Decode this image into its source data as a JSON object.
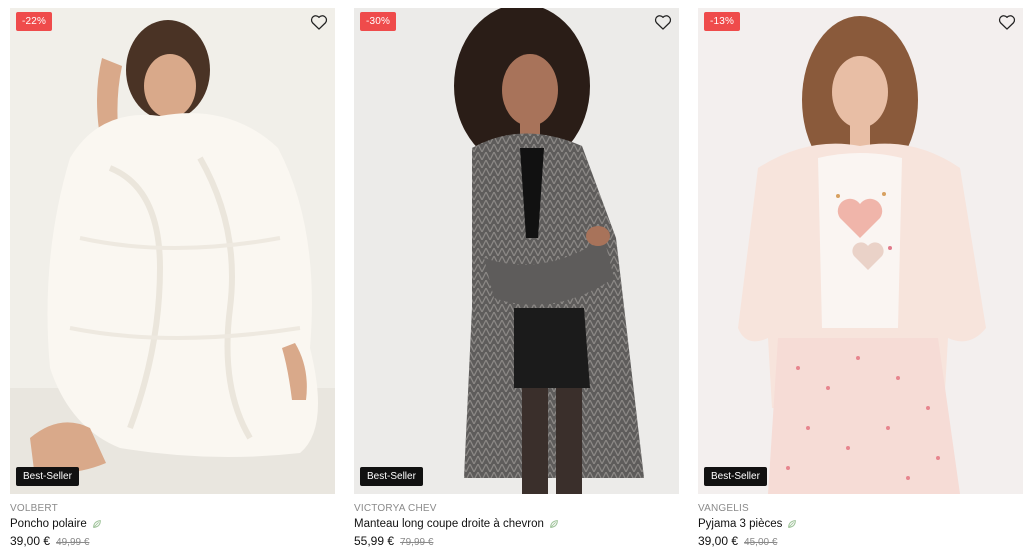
{
  "products": [
    {
      "discount": "-22%",
      "badge": "Best-Seller",
      "brand": "VOLBERT",
      "name": "Poncho polaire",
      "price": "39,00 €",
      "old_price": "49,99 €",
      "icons": {
        "wishlist": "heart-outline-icon",
        "eco": "leaf-icon"
      }
    },
    {
      "discount": "-30%",
      "badge": "Best-Seller",
      "brand": "VICTORYA CHEV",
      "name": "Manteau long coupe droite à chevron",
      "price": "55,99 €",
      "old_price": "79,99 €",
      "icons": {
        "wishlist": "heart-outline-icon",
        "eco": "leaf-icon"
      }
    },
    {
      "discount": "-13%",
      "badge": "Best-Seller",
      "brand": "VANGELIS",
      "name": "Pyjama 3 pièces",
      "price": "39,00 €",
      "old_price": "45,00 €",
      "icons": {
        "wishlist": "heart-outline-icon",
        "eco": "leaf-icon"
      }
    }
  ],
  "colors": {
    "discount_badge": "#ef4b4b",
    "bestseller_badge": "#111111",
    "brand_text": "#8a8a8a",
    "eco_leaf": "#9fc39a"
  }
}
